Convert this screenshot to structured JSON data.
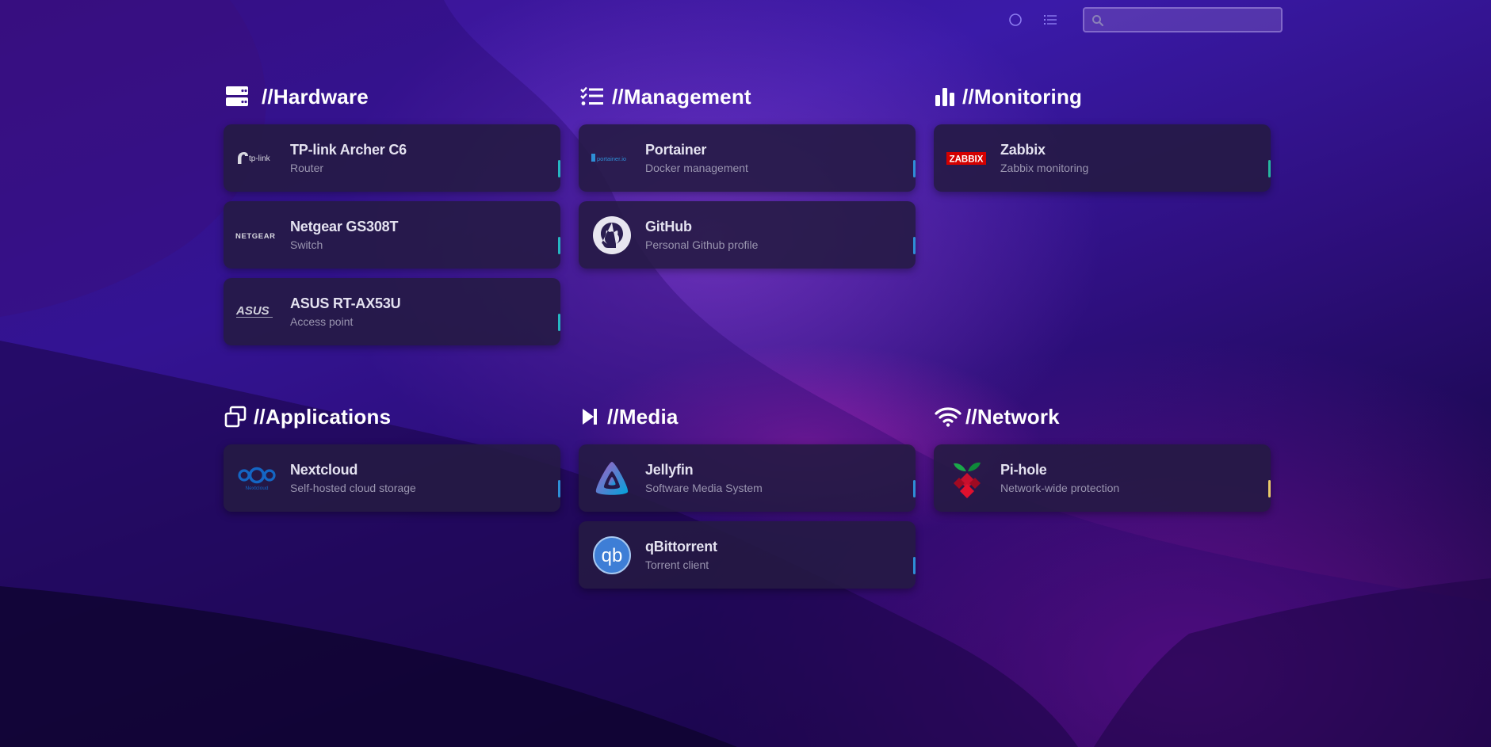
{
  "search": {
    "placeholder": "",
    "value": ""
  },
  "sections": [
    {
      "title": "//Hardware",
      "icon": "server-icon",
      "items": [
        {
          "name": "TP-link Archer C6",
          "sub": "Router",
          "logo": "tp-link-logo",
          "logo_text": "tp-link",
          "tag_color": "#26b6c2"
        },
        {
          "name": "Netgear GS308T",
          "sub": "Switch",
          "logo": "netgear-logo",
          "logo_text": "NETGEAR",
          "tag_color": "#26b6c2"
        },
        {
          "name": "ASUS RT-AX53U",
          "sub": "Access point",
          "logo": "asus-logo",
          "logo_text": "ASUS",
          "tag_color": "#26b6c2"
        }
      ]
    },
    {
      "title": "//Management",
      "icon": "checklist-icon",
      "items": [
        {
          "name": "Portainer",
          "sub": "Docker management",
          "logo": "portainer-logo",
          "logo_text": "portainer.io",
          "tag_color": "#2e8fd6"
        },
        {
          "name": "GitHub",
          "sub": "Personal Github profile",
          "logo": "github-logo",
          "tag_color": "#2e8fd6"
        }
      ]
    },
    {
      "title": "//Monitoring",
      "icon": "bar-chart-icon",
      "items": [
        {
          "name": "Zabbix",
          "sub": "Zabbix monitoring",
          "logo": "zabbix-logo",
          "logo_text": "ZABBIX",
          "tag_color": "#26b6a0"
        }
      ]
    },
    {
      "title": "//Applications",
      "icon": "windows-icon",
      "items": [
        {
          "name": "Nextcloud",
          "sub": "Self-hosted cloud storage",
          "logo": "nextcloud-logo",
          "logo_text": "Nextcloud",
          "tag_color": "#2e8fd6"
        }
      ]
    },
    {
      "title": "//Media",
      "icon": "play-next-icon",
      "items": [
        {
          "name": "Jellyfin",
          "sub": "Software Media System",
          "logo": "jellyfin-logo",
          "tag_color": "#2e8fd6"
        },
        {
          "name": "qBittorrent",
          "sub": "Torrent client",
          "logo": "qbittorrent-logo",
          "logo_text": "qb",
          "tag_color": "#2e8fd6"
        }
      ]
    },
    {
      "title": "//Network",
      "icon": "wifi-icon",
      "items": [
        {
          "name": "Pi-hole",
          "sub": "Network-wide protection",
          "logo": "pihole-logo",
          "tag_color": "#e8c96a"
        }
      ]
    }
  ],
  "colors": {
    "accent_teal": "#26b6c2",
    "accent_blue": "#2e8fd6",
    "accent_yellow": "#e8c96a",
    "card_bg": "#241a42",
    "title": "#ffffff"
  }
}
